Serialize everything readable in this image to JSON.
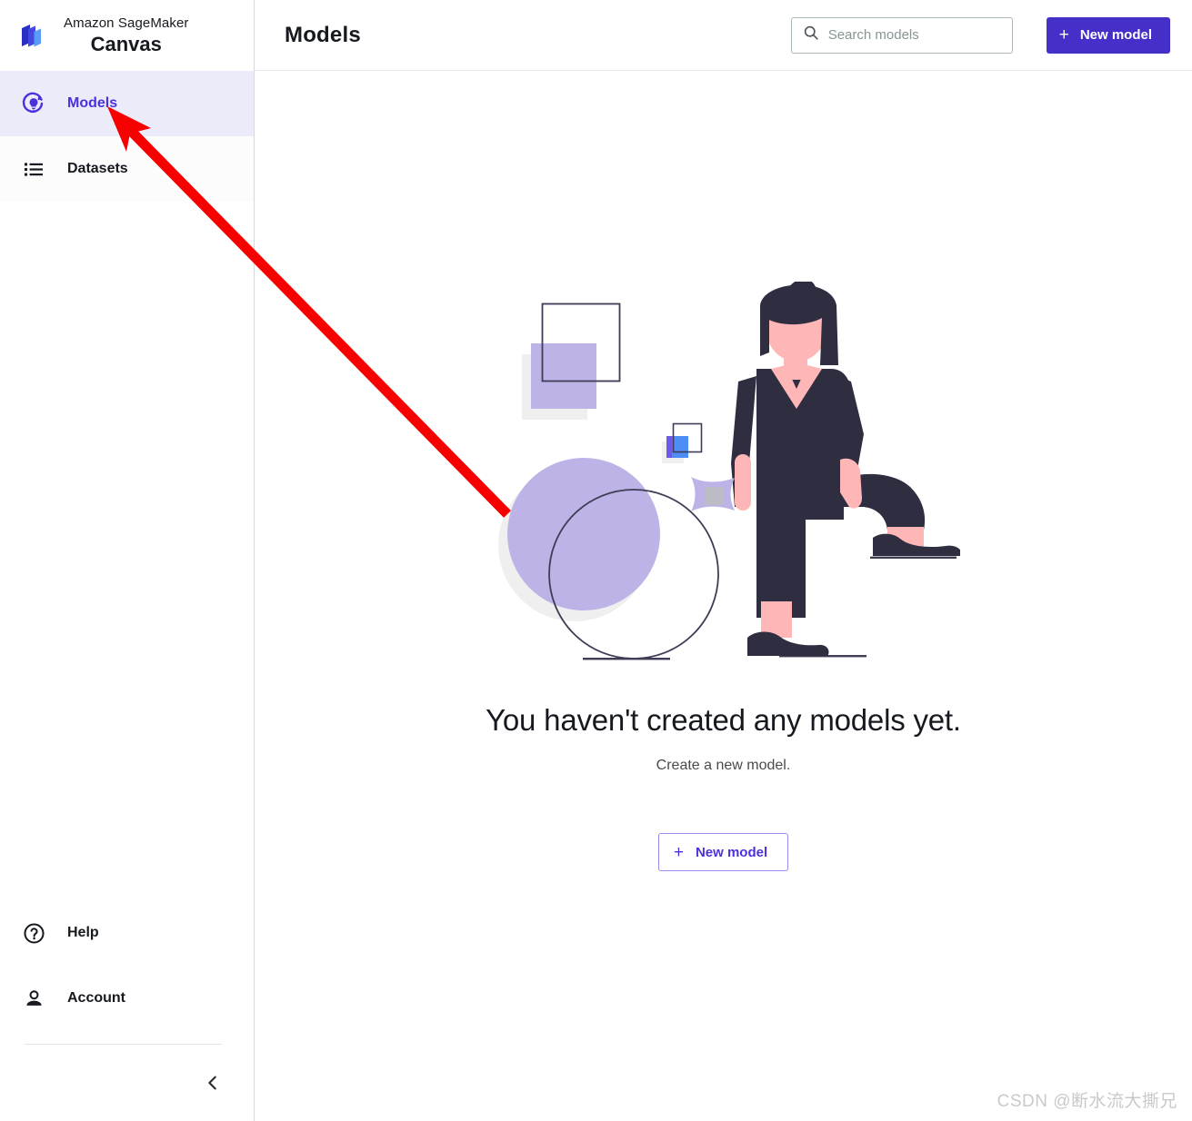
{
  "brand": {
    "line1": "Amazon SageMaker",
    "line2": "Canvas",
    "logo_icon": "sagemaker-logo-icon"
  },
  "sidebar": {
    "items": [
      {
        "label": "Models",
        "icon": "models-lightbulb-refresh-icon",
        "active": true
      },
      {
        "label": "Datasets",
        "icon": "list-icon",
        "active": false
      }
    ],
    "bottom_items": [
      {
        "label": "Help",
        "icon": "question-circle-icon"
      },
      {
        "label": "Account",
        "icon": "person-icon"
      }
    ],
    "collapse_icon": "chevron-left-icon"
  },
  "header": {
    "title": "Models",
    "search": {
      "placeholder": "Search models",
      "value": "",
      "icon": "search-icon"
    },
    "new_model_button": {
      "label": "New model",
      "plus": "+"
    }
  },
  "empty_state": {
    "title": "You haven't created any models yet.",
    "subtitle": "Create a new model.",
    "button": {
      "label": "New model",
      "plus": "+"
    },
    "illustration": "woman-with-geometric-shapes-illustration"
  },
  "watermark": {
    "text": "CSDN @断水流大撕兄"
  },
  "annotation": {
    "arrow": "red-pointer-arrow-to-models"
  },
  "colors": {
    "accent": "#4430c8",
    "accent_text": "#4b31dd",
    "active_row": "#ecebf9",
    "annotation_red": "#f70000",
    "illustration_purple": "#bdb3e6",
    "illustration_dark": "#2f2e41",
    "illustration_skin": "#ffb6b6",
    "illustration_blue": "#4d8df6"
  }
}
